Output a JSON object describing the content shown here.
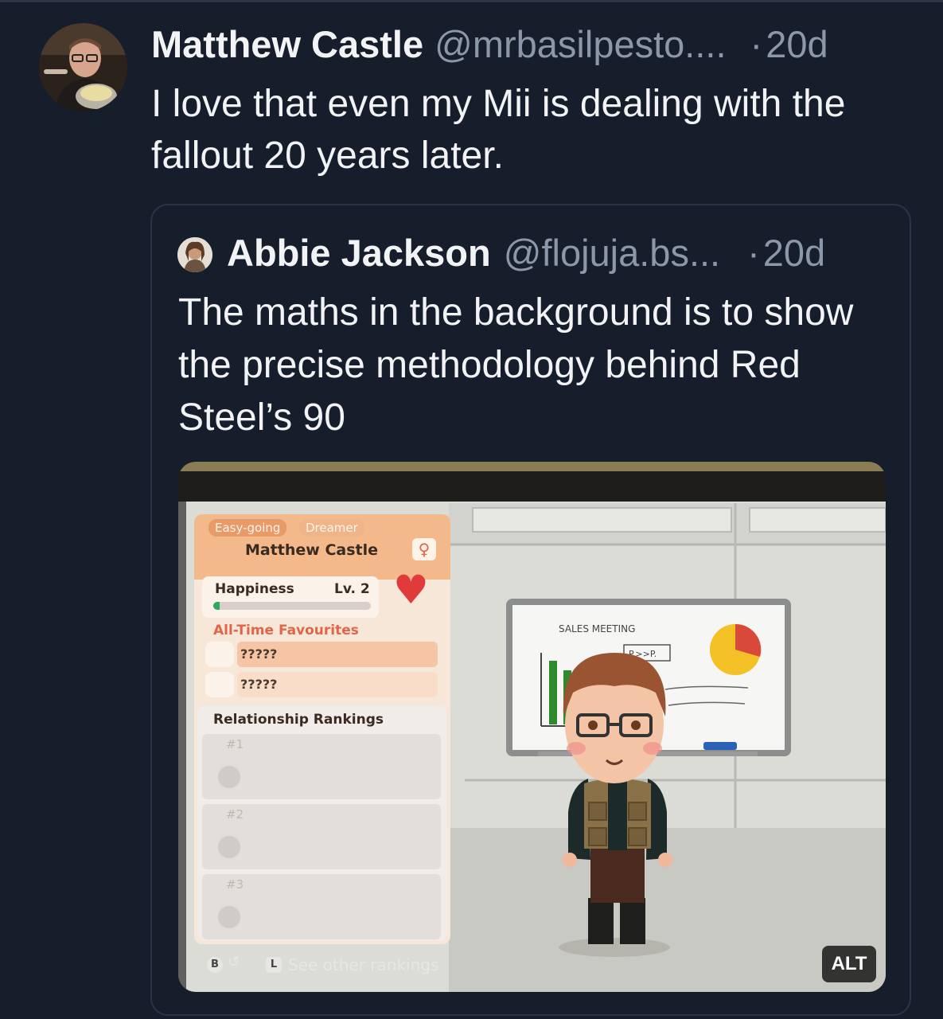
{
  "post": {
    "author_name": "Matthew Castle",
    "handle": "@mrbasilpesto....",
    "separator": "·",
    "age": "20d",
    "text": "I love that even my Mii is dealing with the fallout 20 years later."
  },
  "quoted_post": {
    "author_name": "Abbie Jackson",
    "handle": "@flojuja.bs...",
    "separator": "·",
    "age": "20d",
    "text": "The maths in the background is to show the precise methodology behind Red Steel’s 90",
    "alt_label": "ALT"
  },
  "game_screen": {
    "trait_1": "Easy-going",
    "trait_2": "Dreamer",
    "mii_name": "Matthew Castle",
    "happiness_label": "Happiness",
    "level": "Lv. 2",
    "happiness_fill": 0.04,
    "favourites_heading": "All-Time Favourites",
    "favourites": [
      "?????",
      "?????"
    ],
    "rankings_heading": "Relationship Rankings",
    "rankings": [
      "#1",
      "#2",
      "#3"
    ],
    "footer_hint": "See other rankings",
    "button_b": "B",
    "button_l": "L",
    "whiteboard_title": "SALES MEETING",
    "whiteboard_formula": "P.>>P."
  },
  "colors": {
    "background": "#161e2b",
    "text_primary": "#f1f3f5",
    "text_secondary": "#8b98a9",
    "border": "#2a3444",
    "game_orange": "#f3b98a",
    "game_accent": "#e0664a"
  }
}
